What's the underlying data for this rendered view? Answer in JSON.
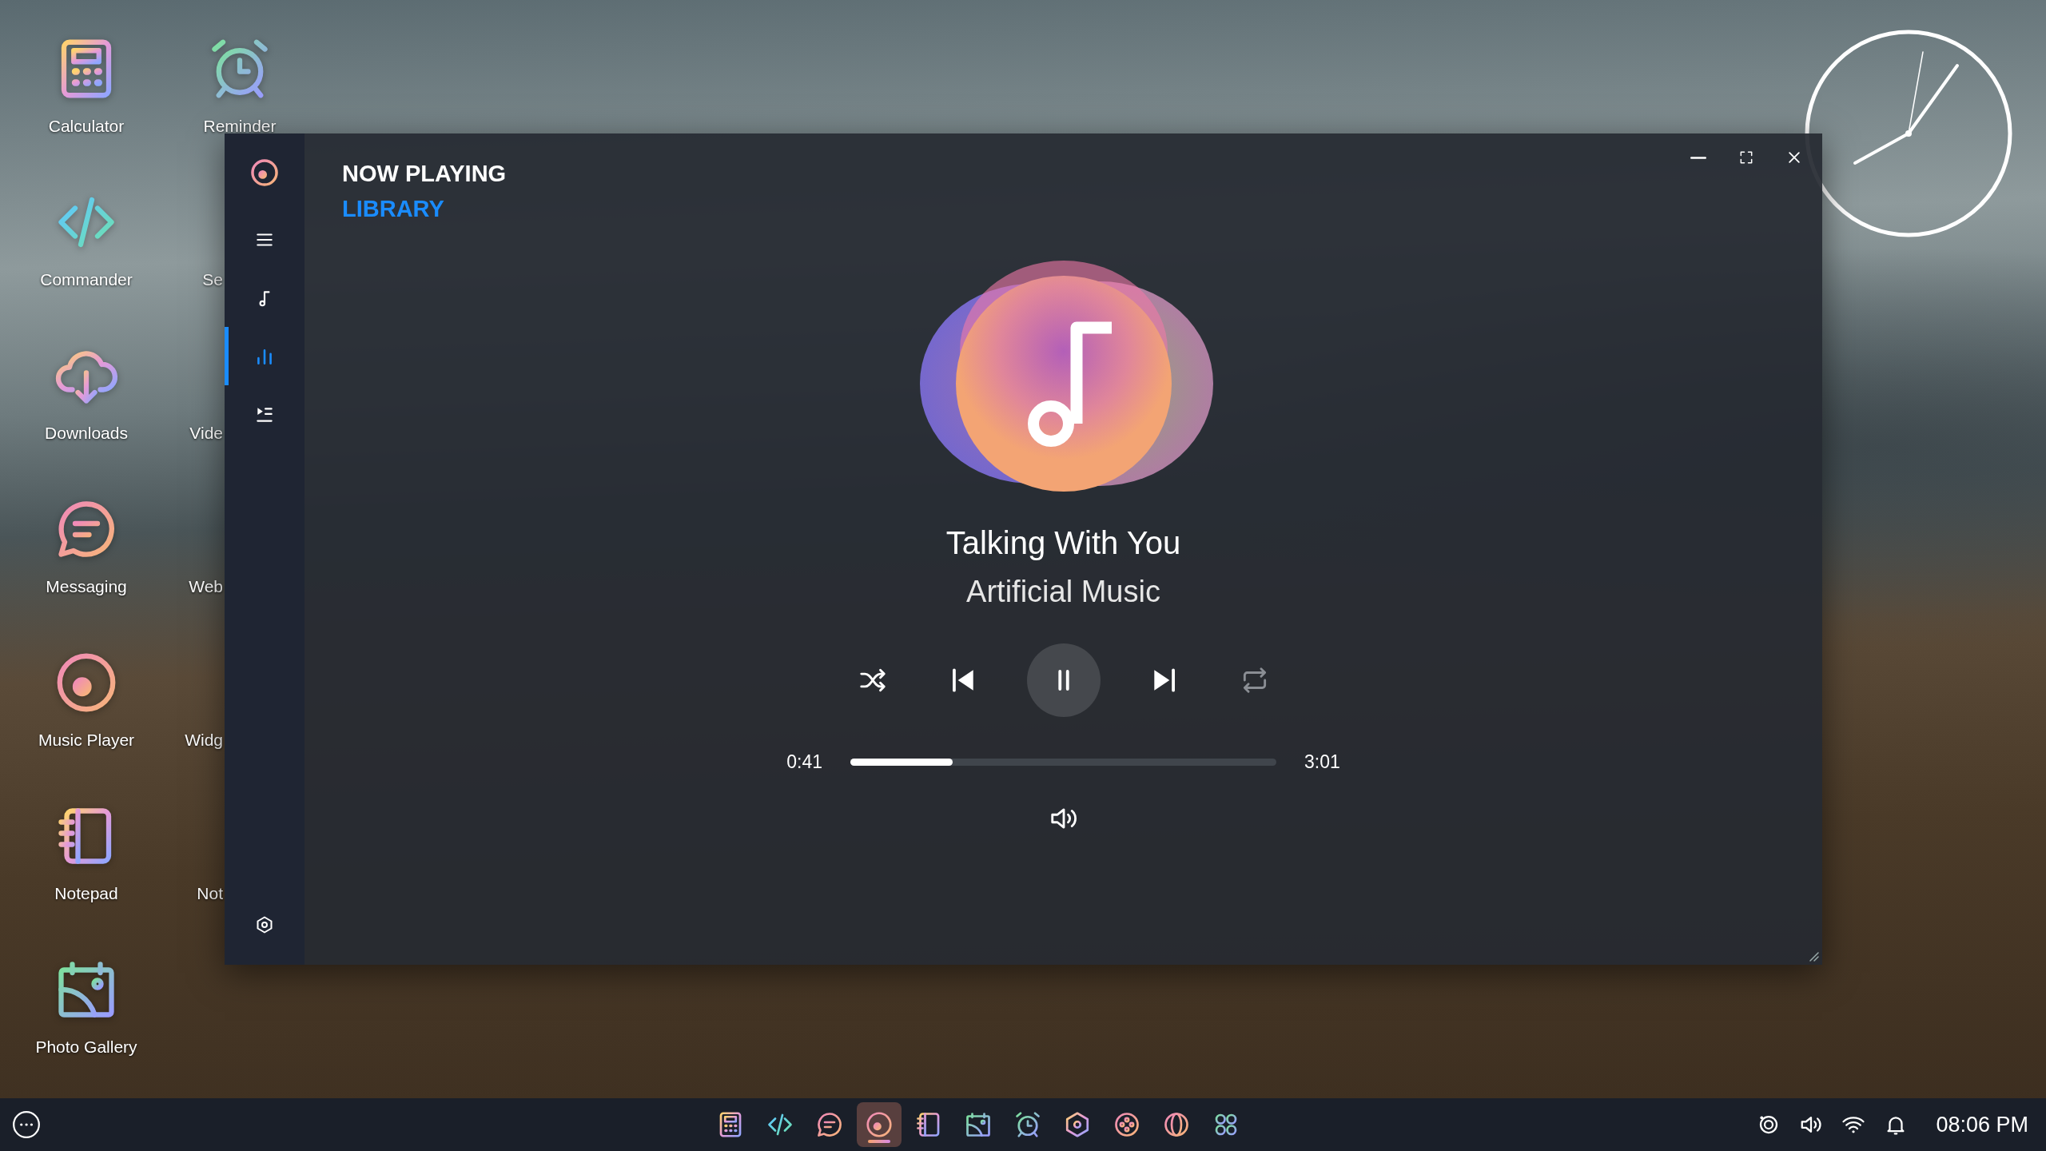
{
  "desktop": {
    "column_1": [
      {
        "label": "Calculator"
      },
      {
        "label": "Commander"
      },
      {
        "label": "Downloads"
      },
      {
        "label": "Messaging"
      },
      {
        "label": "Music Player"
      },
      {
        "label": "Notepad"
      },
      {
        "label": "Photo Gallery"
      }
    ],
    "column_2": [
      {
        "label": "Reminder"
      },
      {
        "label": "Se"
      },
      {
        "label": "Vide"
      },
      {
        "label": "Web"
      },
      {
        "label": "Widg"
      },
      {
        "label": "Not"
      }
    ]
  },
  "window": {
    "nav": [
      {
        "label": "NOW PLAYING",
        "selected": true
      },
      {
        "label": "LIBRARY",
        "selected": false
      }
    ],
    "sidebar": {
      "items": [
        {
          "selected": false
        },
        {
          "selected": false
        },
        {
          "selected": true
        },
        {
          "selected": false
        }
      ]
    },
    "track": {
      "title": "Talking With You",
      "artist": "Artificial Music"
    },
    "playback": {
      "playing": true,
      "repeat_on": false,
      "elapsed": "0:41",
      "duration": "3:01",
      "level": 0.24
    }
  },
  "taskbar": {
    "apps": [
      {
        "selected": false
      },
      {
        "selected": false
      },
      {
        "selected": false
      },
      {
        "selected": true
      },
      {
        "selected": false
      },
      {
        "selected": false
      },
      {
        "selected": false
      },
      {
        "selected": false
      },
      {
        "selected": false
      },
      {
        "selected": false
      },
      {
        "selected": false
      }
    ],
    "time": "08:06 PM"
  }
}
